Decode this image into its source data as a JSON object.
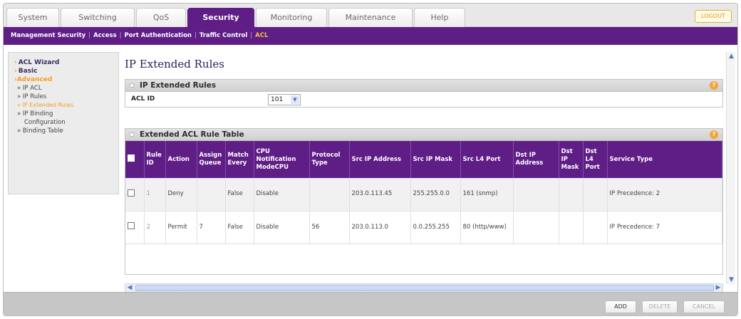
{
  "tabs": [
    {
      "label": "System",
      "active": false
    },
    {
      "label": "Switching",
      "active": false
    },
    {
      "label": "QoS",
      "active": false
    },
    {
      "label": "Security",
      "active": true
    },
    {
      "label": "Monitoring",
      "active": false
    },
    {
      "label": "Maintenance",
      "active": false
    },
    {
      "label": "Help",
      "active": false
    }
  ],
  "logout_label": "LOGOUT",
  "subnav": {
    "items": [
      "Management Security",
      "Access",
      "Port Authentication",
      "Traffic Control",
      "ACL"
    ],
    "selected": "ACL"
  },
  "leftmenu": {
    "items": [
      {
        "label": "ACL Wizard",
        "kind": "top"
      },
      {
        "label": "Basic",
        "kind": "top"
      },
      {
        "label": "Advanced",
        "kind": "top-selected"
      },
      {
        "label": "» IP ACL",
        "kind": "sub"
      },
      {
        "label": "» IP Rules",
        "kind": "sub"
      },
      {
        "label": "» IP Extended Rules",
        "kind": "sub-selected"
      },
      {
        "label": "» IP Binding",
        "kind": "sub"
      },
      {
        "label": "Configuration",
        "kind": "sub-cont"
      },
      {
        "label": "» Binding Table",
        "kind": "sub"
      }
    ]
  },
  "page_title": "IP Extended Rules",
  "section1": {
    "title": "IP Extended Rules",
    "acl_id_label": "ACL ID",
    "acl_id_value": "101"
  },
  "section2": {
    "title": "Extended ACL Rule Table",
    "columns": [
      "",
      "Rule ID",
      "Action",
      "Assign Queue",
      "Match Every",
      "CPU Notification ModeCPU",
      "Protocol Type",
      "Src IP Address",
      "Src IP Mask",
      "Src L4 Port",
      "Dst IP Address",
      "Dst IP Mask",
      "Dst L4 Port",
      "Service Type"
    ],
    "rows": [
      [
        "",
        "1",
        "Deny",
        "",
        "False",
        "Disable",
        "",
        "203.0.113.45",
        "255.255.0.0",
        "161 (snmp)",
        "",
        "",
        "",
        "IP Precedence: 2"
      ],
      [
        "",
        "2",
        "Permit",
        "7",
        "False",
        "Disable",
        "56",
        "203.0.113.0",
        "0.0.255.255",
        "80 (http/www)",
        "",
        "",
        "",
        "IP Precedence: 7"
      ]
    ]
  },
  "help_glyph": "?",
  "footer": {
    "add": "ADD",
    "delete": "DELETE",
    "cancel": "CANCEL"
  },
  "icons": {
    "menu_arrow": "›",
    "dropdown": "chevron-down-icon",
    "scroll_left": "◀",
    "scroll_right": "▶",
    "scroll_up": "▲",
    "scroll_down": "▼"
  },
  "colors": {
    "brand_purple": "#5f1d86",
    "accent_orange": "#f0a020",
    "help_orange": "#f3a43a"
  }
}
